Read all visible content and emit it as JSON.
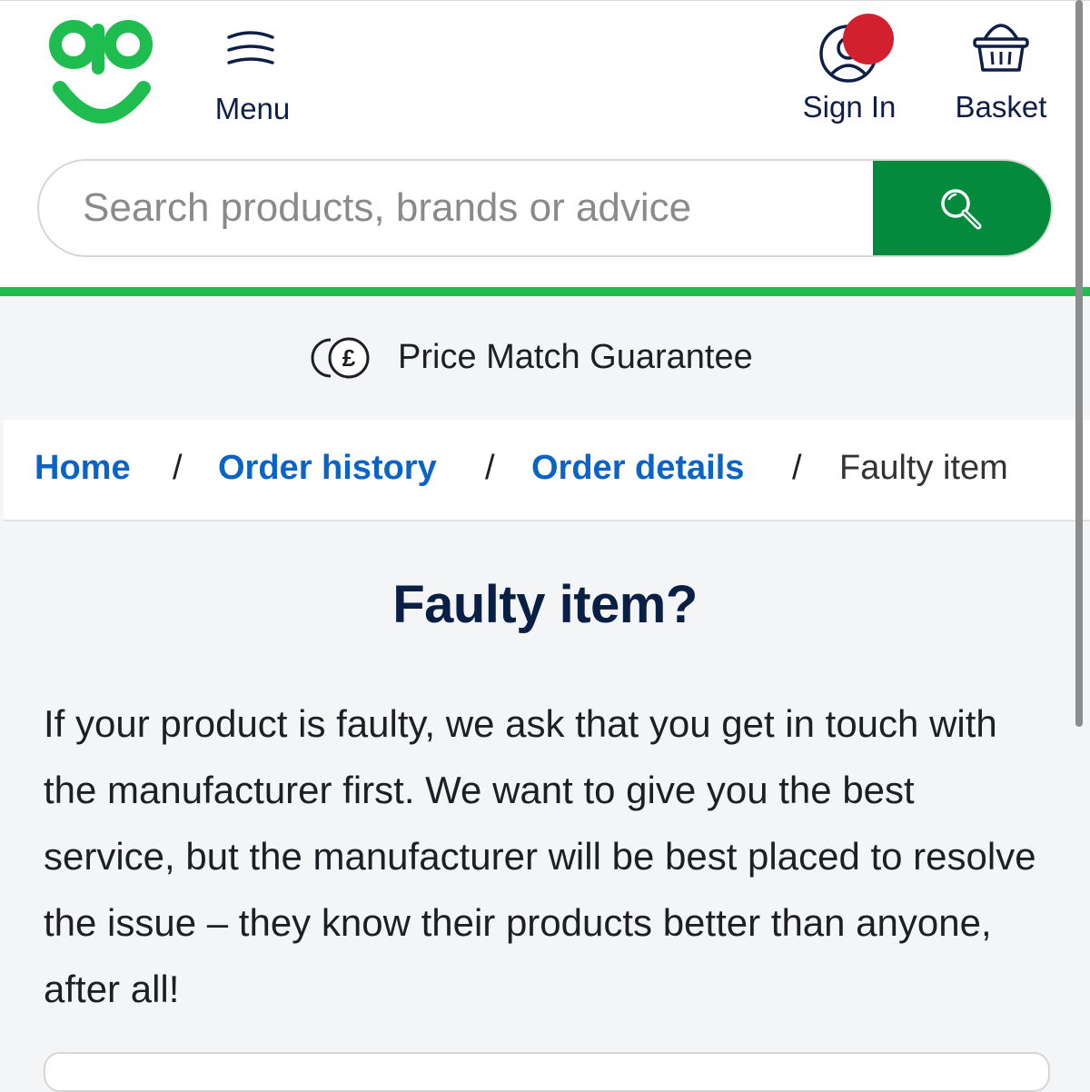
{
  "header": {
    "logo": "ao",
    "menu_label": "Menu",
    "signin_label": "Sign In",
    "basket_label": "Basket"
  },
  "search": {
    "placeholder": "Search products, brands or advice"
  },
  "promo": {
    "text": "Price Match Guarantee"
  },
  "breadcrumb": {
    "items": [
      {
        "label": "Home",
        "link": true
      },
      {
        "label": "Order history",
        "link": true
      },
      {
        "label": "Order details",
        "link": true
      },
      {
        "label": "Faulty item",
        "link": false
      }
    ],
    "separator": "/"
  },
  "main": {
    "title": "Faulty item?",
    "body": "If your product is faulty, we ask that you get in touch with the manufacturer first. We want to give you the best service, but the manufacturer will be best placed to resolve the issue – they know their products better than anyone, after all!"
  },
  "colors": {
    "brand_green": "#1fbd4f",
    "search_button": "#048a3d",
    "link_blue": "#0b63c6",
    "navy": "#0a1f44",
    "notification_dot": "#d2202f"
  },
  "icons": [
    "ao-logo",
    "menu-icon",
    "user-icon",
    "basket-icon",
    "search-icon",
    "pound-coin-icon"
  ]
}
